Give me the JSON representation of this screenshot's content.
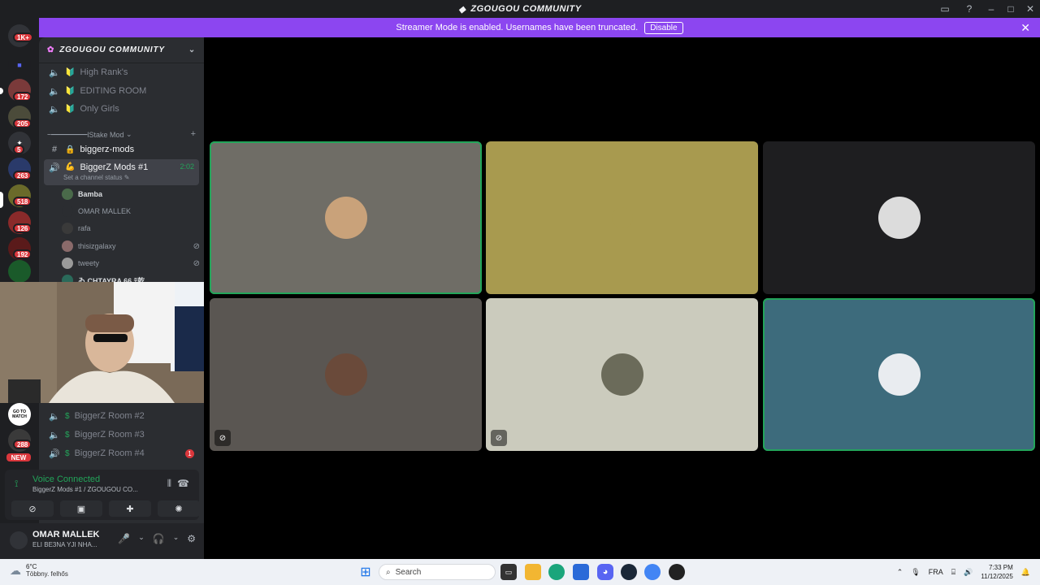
{
  "window": {
    "title": "ZGOUGOU COMMUNITY"
  },
  "banner": {
    "text": "Streamer Mode is enabled. Usernames have been truncated.",
    "button": "Disable"
  },
  "servers": {
    "home_badge": "1K+",
    "badges": [
      "172",
      "205",
      "5",
      "263",
      "518",
      "126",
      "192",
      "288"
    ],
    "new_label": "NEW",
    "gotomatch_label": "GO TO MATCH"
  },
  "guild": {
    "name": "ZGOUGOU COMMUNITY"
  },
  "channels_top": [
    {
      "name": "High Rank's"
    },
    {
      "name": "EDITING ROOM"
    },
    {
      "name": "Only Girls"
    }
  ],
  "category": {
    "name": "ｰ━━━━━lStake Mod"
  },
  "text_channel": {
    "name": "biggerz-mods"
  },
  "active_voice": {
    "name": "BiggerZ Mods #1",
    "timer": "2:02",
    "status": "Set a channel status"
  },
  "members": [
    {
      "name": "Bamba"
    },
    {
      "name": "OMAR MALLEK"
    },
    {
      "name": "rafa"
    },
    {
      "name": "thisizgalaxy"
    },
    {
      "name": "tweety"
    },
    {
      "name": "ゐ CHTAYRA 66 ﾃ乾"
    }
  ],
  "rooms": [
    {
      "name": "BiggerZ Room #2"
    },
    {
      "name": "BiggerZ Room #3"
    },
    {
      "name": "BiggerZ Room #4",
      "badge": "1"
    }
  ],
  "voice_panel": {
    "title": "Voice Connected",
    "subtitle": "BiggerZ Mods #1 / ZGOUGOU CO..."
  },
  "user": {
    "name": "OMAR MALLEK",
    "status": "ELI BE3NA YJI NHA..."
  },
  "tiles": [
    {
      "bg": "#6f6d66",
      "speaking": true,
      "muted": false,
      "avatar_color": "#c9a27a"
    },
    {
      "bg": "#a89a4f",
      "speaking": false,
      "muted": false,
      "avatar_color": "#a89a4f"
    },
    {
      "bg": "#1e1e20",
      "speaking": false,
      "muted": false,
      "avatar_color": "#dcdcdc"
    },
    {
      "bg": "#5a5652",
      "speaking": false,
      "muted": true,
      "avatar_color": "#6a4a3a"
    },
    {
      "bg": "#cbcbbd",
      "speaking": false,
      "muted": true,
      "avatar_color": "#6b6b5a"
    },
    {
      "bg": "#3d6b7c",
      "speaking": true,
      "muted": false,
      "avatar_color": "#e9ecf0"
    }
  ],
  "taskbar": {
    "temp": "6°C",
    "weather": "Többny. felhős",
    "search": "Search",
    "lang": "FRA",
    "time": "7:33 PM",
    "date": "11/12/2025"
  },
  "colors": {
    "accent": "#8c46f0",
    "green": "#23a55a",
    "red": "#da373c"
  }
}
